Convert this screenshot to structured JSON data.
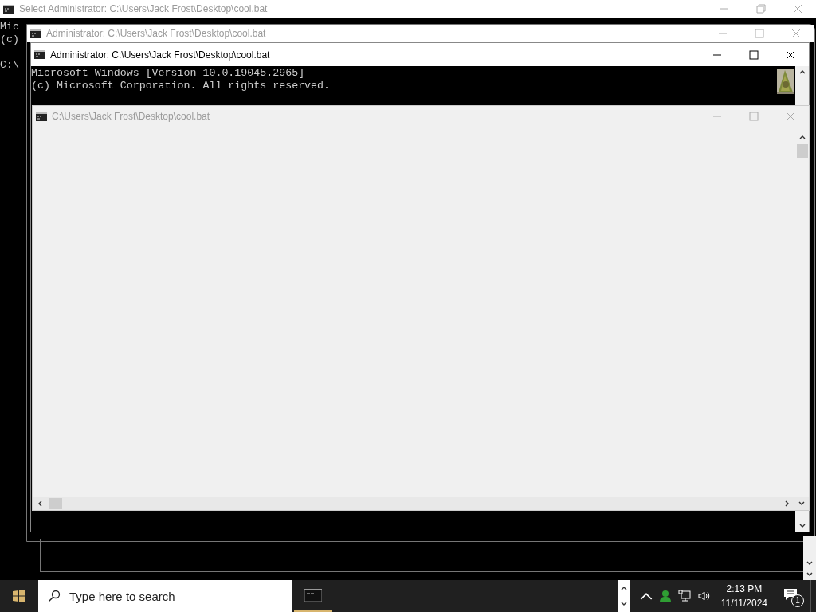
{
  "back_window": {
    "title": "Select Administrator: C:\\Users\\Jack Frost\\Desktop\\cool.bat",
    "active": false,
    "maximized": true,
    "lines": [
      "Mic",
      "(c)"
    ],
    "prompt": "C:\\"
  },
  "middle_window": {
    "title": "Administrator: C:\\Users\\Jack Frost\\Desktop\\cool.bat",
    "active": false,
    "maximized": false
  },
  "front_window": {
    "title": "Administrator: C:\\Users\\Jack Frost\\Desktop\\cool.bat",
    "active": true,
    "maximized": false,
    "lines": [
      "Microsoft Windows [Version 10.0.19045.2965]",
      "(c) Microsoft Corporation. All rights reserved."
    ]
  },
  "blank_window": {
    "title": "C:\\Users\\Jack Frost\\Desktop\\cool.bat",
    "active": false,
    "maximized": false
  },
  "taskbar": {
    "search": {
      "placeholder": "Type here to search"
    },
    "time": "2:13 PM",
    "date": "11/11/2024",
    "notification_count": "1"
  }
}
